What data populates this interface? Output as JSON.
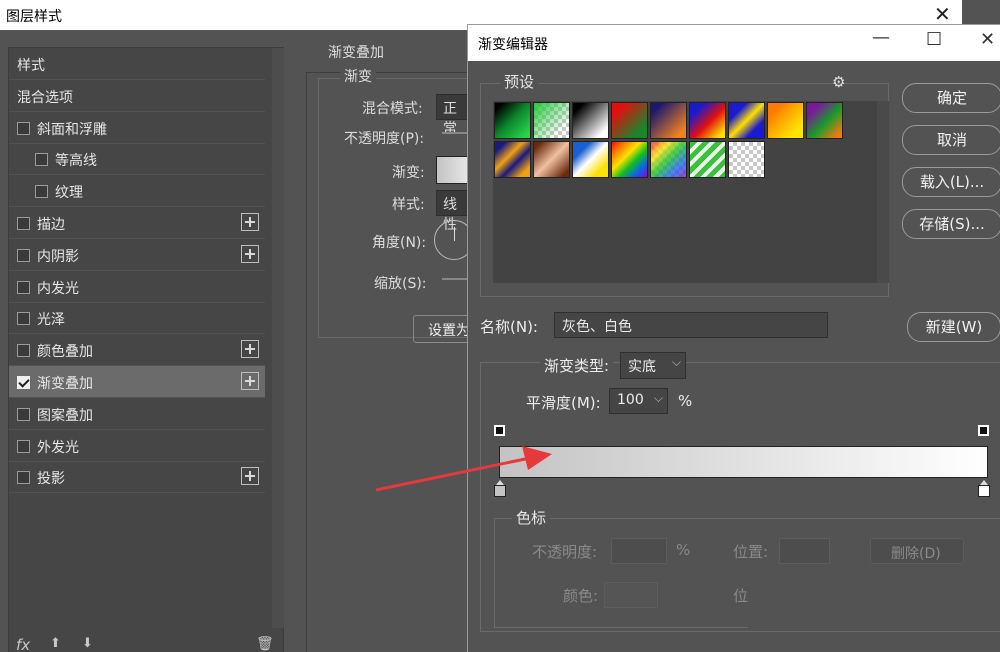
{
  "layer_style": {
    "title": "图层样式",
    "styles": [
      {
        "label": "样式",
        "checkbox": false,
        "plus": false,
        "indent": 0
      },
      {
        "label": "混合选项",
        "checkbox": false,
        "plus": false,
        "indent": 0
      },
      {
        "label": "斜面和浮雕",
        "checkbox": true,
        "checked": false,
        "plus": false,
        "indent": 0
      },
      {
        "label": "等高线",
        "checkbox": true,
        "checked": false,
        "plus": false,
        "indent": 1
      },
      {
        "label": "纹理",
        "checkbox": true,
        "checked": false,
        "plus": false,
        "indent": 1
      },
      {
        "label": "描边",
        "checkbox": true,
        "checked": false,
        "plus": true,
        "indent": 0
      },
      {
        "label": "内阴影",
        "checkbox": true,
        "checked": false,
        "plus": true,
        "indent": 0
      },
      {
        "label": "内发光",
        "checkbox": true,
        "checked": false,
        "plus": false,
        "indent": 0
      },
      {
        "label": "光泽",
        "checkbox": true,
        "checked": false,
        "plus": false,
        "indent": 0
      },
      {
        "label": "颜色叠加",
        "checkbox": true,
        "checked": false,
        "plus": true,
        "indent": 0
      },
      {
        "label": "渐变叠加",
        "checkbox": true,
        "checked": true,
        "plus": true,
        "indent": 0,
        "selected": true
      },
      {
        "label": "图案叠加",
        "checkbox": true,
        "checked": false,
        "plus": false,
        "indent": 0
      },
      {
        "label": "外发光",
        "checkbox": true,
        "checked": false,
        "plus": false,
        "indent": 0
      },
      {
        "label": "投影",
        "checkbox": true,
        "checked": false,
        "plus": true,
        "indent": 0
      }
    ],
    "footer": {
      "fx": "fx",
      "up": "⬆",
      "down": "⬇",
      "trash": "🗑"
    },
    "gradient_overlay": {
      "section_title": "渐变叠加",
      "sub_title": "渐变",
      "blend_mode_label": "混合模式:",
      "blend_mode_value": "正常",
      "opacity_label": "不透明度(P):",
      "gradient_label": "渐变:",
      "style_label": "样式:",
      "style_value": "线性",
      "angle_label": "角度(N):",
      "scale_label": "缩放(S):",
      "set_default_button": "设置为"
    }
  },
  "gradient_editor": {
    "title": "渐变编辑器",
    "presets_legend": "预设",
    "gear": "⚙",
    "buttons": {
      "ok": "确定",
      "cancel": "取消",
      "load": "载入(L)...",
      "save": "存储(S)...",
      "new": "新建(W)"
    },
    "name_label": "名称(N):",
    "name_value": "灰色、白色",
    "type_label": "渐变类型:",
    "type_value": "实底",
    "smooth_label": "平滑度(M):",
    "smooth_value": "100",
    "smooth_unit": "%",
    "stops_legend": "色标",
    "opacity_label": "不透明度:",
    "opacity_unit": "%",
    "position_label": "位置:",
    "delete_button": "删除(D)",
    "color_label": "颜色:",
    "position_label_2": "位",
    "gradient_colors": {
      "start": "#c3c3c3",
      "end": "#ffffff"
    },
    "arrow_color": "#e5393b"
  }
}
